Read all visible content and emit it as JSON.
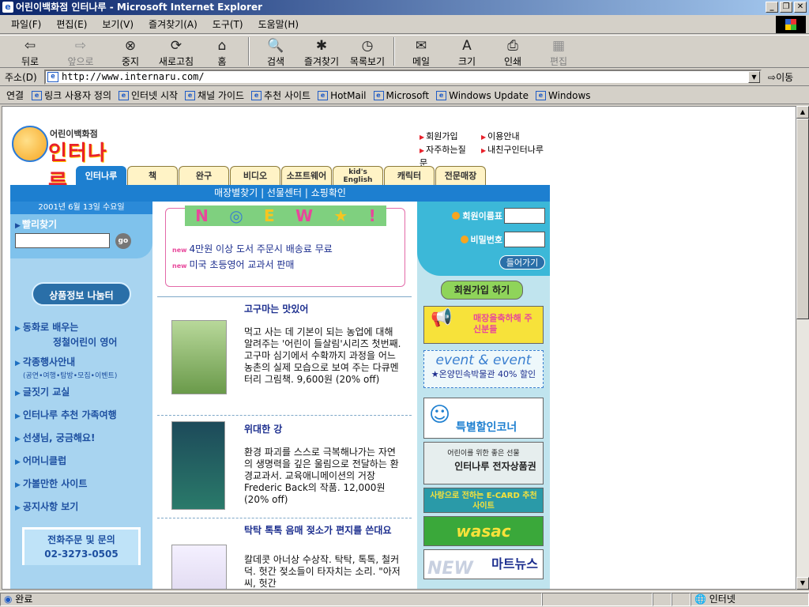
{
  "window": {
    "title": "어린이백화점 인터나루 - Microsoft Internet Explorer",
    "app_icon": "e-icon"
  },
  "menubar": {
    "items": [
      "파일(F)",
      "편집(E)",
      "보기(V)",
      "즐겨찾기(A)",
      "도구(T)",
      "도움말(H)"
    ]
  },
  "toolbar": {
    "buttons": [
      {
        "label": "뒤로",
        "icon": "back-arrow-icon",
        "glyph": "⇦"
      },
      {
        "label": "앞으로",
        "icon": "forward-arrow-icon",
        "glyph": "⇨"
      },
      {
        "label": "중지",
        "icon": "stop-icon",
        "glyph": "⊗"
      },
      {
        "label": "새로고침",
        "icon": "refresh-icon",
        "glyph": "⟳"
      },
      {
        "label": "홈",
        "icon": "home-icon",
        "glyph": "⌂"
      },
      {
        "label": "검색",
        "icon": "search-icon",
        "glyph": "🔍"
      },
      {
        "label": "즐겨찾기",
        "icon": "favorites-icon",
        "glyph": "✱"
      },
      {
        "label": "목록보기",
        "icon": "history-icon",
        "glyph": "◷"
      },
      {
        "label": "메일",
        "icon": "mail-icon",
        "glyph": "✉"
      },
      {
        "label": "크기",
        "icon": "font-size-icon",
        "glyph": "A"
      },
      {
        "label": "인쇄",
        "icon": "print-icon",
        "glyph": "⎙"
      },
      {
        "label": "편집",
        "icon": "edit-icon",
        "glyph": "▦"
      }
    ]
  },
  "address": {
    "label": "주소(D)",
    "url": "http://www.internaru.com/",
    "go_label": "이동"
  },
  "links": {
    "label": "연결",
    "items": [
      "링크 사용자 정의",
      "인터넷 시작",
      "채널 가이드",
      "추천 사이트",
      "HotMail",
      "Microsoft",
      "Windows Update",
      "Windows"
    ]
  },
  "page": {
    "logo": {
      "small": "어린이백화점",
      "big": "인터나루"
    },
    "top_links": [
      "회원가입",
      "이용안내",
      "자주하는질문",
      "내친구인터나루"
    ],
    "tabs": [
      "인터나루",
      "책",
      "완구",
      "비디오",
      "소프트웨어",
      "kid's English",
      "캐릭터",
      "전문매장"
    ],
    "blue_bar": "매장별찾기 | 선물센터 | 쇼핑확인",
    "date": "2001년 6월 13일 수요일",
    "quick_search": {
      "label": "빨리찾기",
      "go": "go"
    },
    "info_button": "상품정보 나눔터",
    "left_menu": [
      {
        "label": "동화로 배우는",
        "sub": "정철어린이 영어"
      },
      {
        "label": "각종행사안내",
        "sub2": "(공연•여행•탐방•모집•이벤트)"
      },
      {
        "label": "글짓기 교실"
      },
      {
        "label": "인터나루 추천 가족여행"
      },
      {
        "label": "선생님, 궁금해요!"
      },
      {
        "label": "어머니클럽"
      },
      {
        "label": "가볼만한 사이트"
      },
      {
        "label": "공지사항 보기"
      }
    ],
    "phone": {
      "label": "전화주문 및 문의",
      "number": "02-3273-0505"
    },
    "new_box": {
      "title": [
        "N",
        "E",
        "W",
        "!"
      ],
      "items": [
        "4만원 이상 도서 주문시 배송료 무료",
        "미국 초등영어 교과서 판매"
      ]
    },
    "books": [
      {
        "title": "고구마는 맛있어",
        "desc": "먹고 사는 데 기본이 되는 농업에 대해 알려주는 '어린이 들살림'시리즈 첫번째. 고구마 심기에서 수확까지 과정을 어느 농촌의 실제 모습으로 보여 주는 다큐멘터리 그림책. 9,600원 (20% off)"
      },
      {
        "title": "위대한 강",
        "desc": "환경 파괴를 스스로 극복해나가는 자연의 생명력을 깊은 울림으로 전달하는 환경교과서. 교육애니메이션의 거장 Frederic Back의 작품. 12,000원 (20% off)"
      },
      {
        "title": "탁탁 톡톡 음매 젖소가 편지를 쓴대요",
        "desc": "칼데콧 아너상 수상작. 탁탁, 톡톡, 철커덕. 헛간 젖소들이 타자치는 소리. \"아저씨, 헛간"
      }
    ],
    "login": {
      "id_label": "회원이름표",
      "pw_label": "비밀번호",
      "enter": "들어가기"
    },
    "right_banners": {
      "join": "회원가입 하기",
      "opening": "매장을축하해 주신분들",
      "event_title": "event & event",
      "event_item": "★온양민속박물관 40% 할인",
      "special": "특별할인코너",
      "gift_small": "어린이를 위한 좋은 선물",
      "gift_big": "인터나루 전자상품권",
      "ecard": "사랑으로 전하는 E-CARD 추천 사이트",
      "wasac": "wasac",
      "news": "마트뉴스"
    }
  },
  "status": {
    "text": "완료",
    "zone": "인터넷"
  }
}
